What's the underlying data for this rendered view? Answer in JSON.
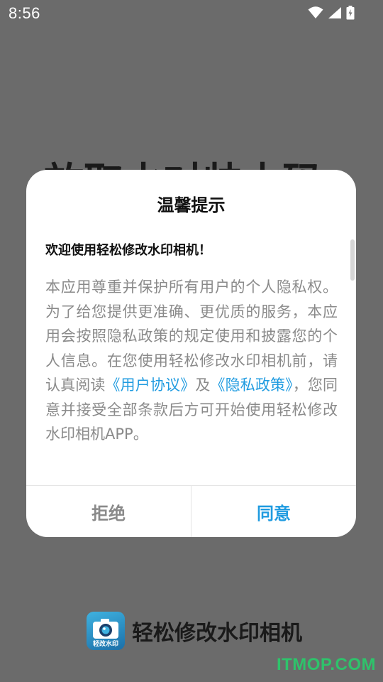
{
  "status_bar": {
    "time": "8:56",
    "icons": [
      "wifi-icon",
      "signal-icon",
      "battery-icon"
    ]
  },
  "background": {
    "title_partial": "放取水对帅本码"
  },
  "dialog": {
    "title": "温馨提示",
    "welcome": "欢迎使用轻松修改水印相机！",
    "terms_before": "本应用尊重并保护所有用户的个人隐私权。为了给您提供更准确、更优质的服务，本应用会按照隐私政策的规定使用和披露您的个人信息。在您使用轻松修改水印相机前，请认真阅读",
    "link_user_agreement": "《用户协议》",
    "terms_and": "及",
    "link_privacy_policy": "《隐私政策》",
    "terms_after": "，您同意并接受全部条款后方可开始使用轻松修改水印相机APP。",
    "reject_label": "拒绝",
    "agree_label": "同意"
  },
  "brand": {
    "app_name": "轻松修改水印相机",
    "icon_label": "轻改水印"
  },
  "watermark": "ITMOP.COM",
  "colors": {
    "overlay": "#6b6b6b",
    "accent": "#1f9be0",
    "muted_text": "#8a8a8a",
    "watermark": "#2ec36b"
  }
}
